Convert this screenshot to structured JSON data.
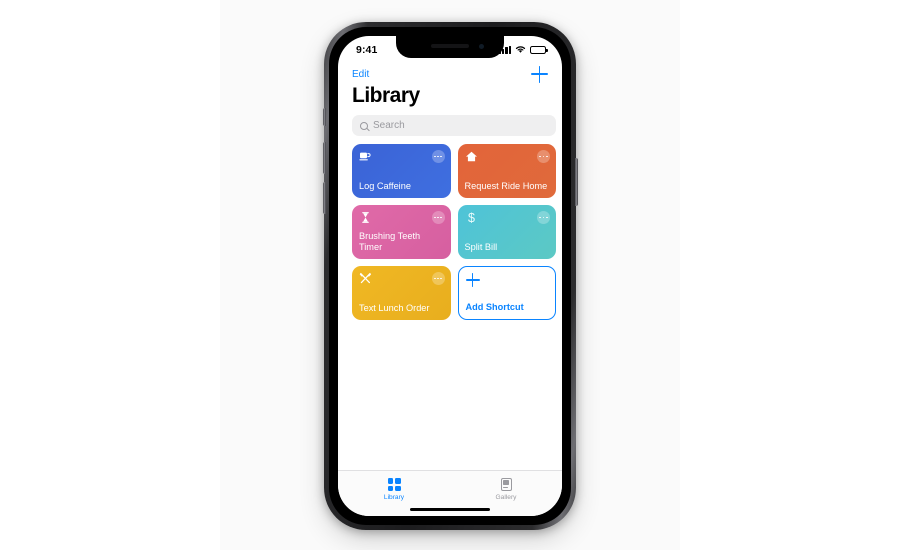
{
  "status_bar": {
    "time": "9:41",
    "signal_icon": "cellular-bars-icon",
    "wifi_icon": "wifi-icon",
    "battery_icon": "battery-icon"
  },
  "nav": {
    "edit_label": "Edit",
    "add_icon": "plus-icon"
  },
  "page_title": "Library",
  "search": {
    "placeholder": "Search",
    "icon": "search-icon"
  },
  "shortcuts": [
    {
      "title": "Log Caffeine",
      "icon": "coffee-cup-icon",
      "color_start": "#3b63d6",
      "color_end": "#3f6fe0",
      "menu_icon": "more-options-icon"
    },
    {
      "title": "Request Ride Home",
      "icon": "home-icon",
      "color_start": "#e2643a",
      "color_end": "#e06a3b",
      "menu_icon": "more-options-icon"
    },
    {
      "title": "Brushing Teeth Timer",
      "icon": "hourglass-icon",
      "color_start": "#e06aa8",
      "color_end": "#d65fa0",
      "menu_icon": "more-options-icon"
    },
    {
      "title": "Split Bill",
      "icon": "dollar-sign-icon",
      "color_start": "#4ec3d8",
      "color_end": "#5cc9c4",
      "menu_icon": "more-options-icon"
    },
    {
      "title": "Text Lunch Order",
      "icon": "fork-knife-icon",
      "color_start": "#f0b824",
      "color_end": "#e8ae1e",
      "menu_icon": "more-options-icon"
    }
  ],
  "add_shortcut": {
    "label": "Add Shortcut",
    "icon": "plus-icon",
    "accent": "#0a84ff"
  },
  "tab_bar": {
    "tabs": [
      {
        "label": "Library",
        "icon": "grid-icon",
        "active": true
      },
      {
        "label": "Gallery",
        "icon": "gallery-card-icon",
        "active": false
      }
    ]
  }
}
